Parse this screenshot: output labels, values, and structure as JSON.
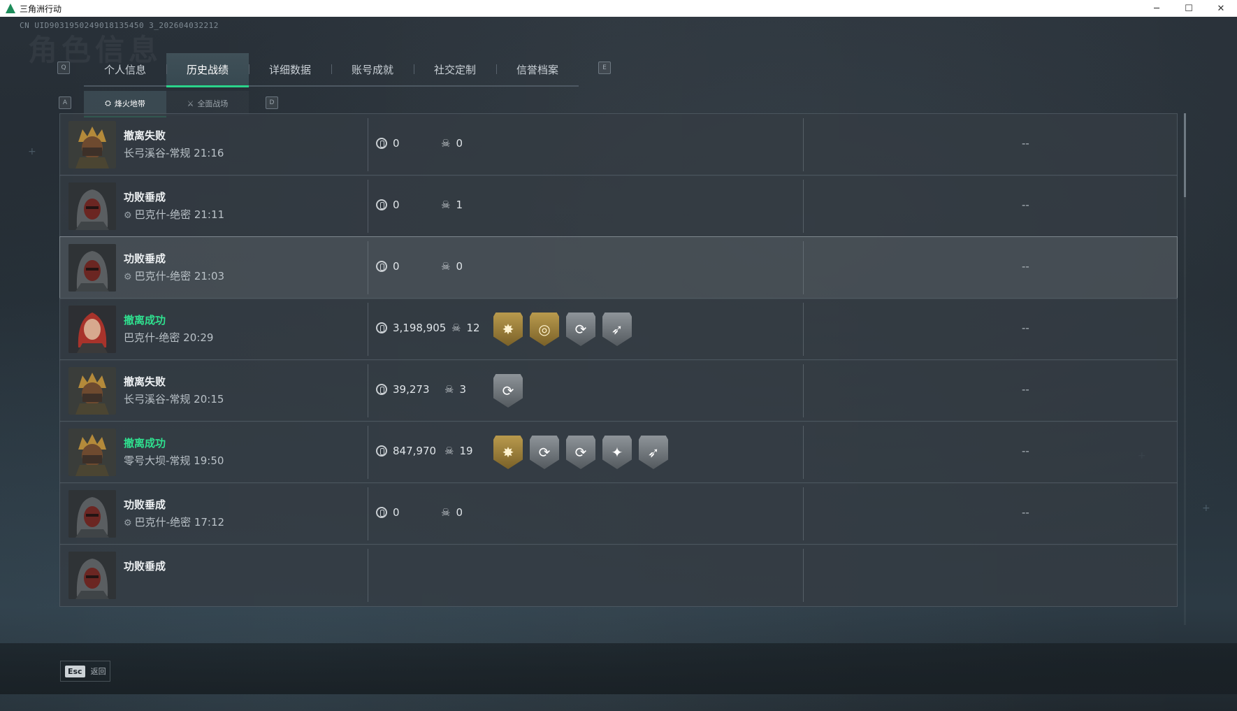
{
  "window": {
    "title": "三角洲行动",
    "controls": [
      "─",
      "☐",
      "✕"
    ]
  },
  "uid": "CN UID9031950249018135450 3_202604032212",
  "ghost_title": "角色信息",
  "key_hints": {
    "prev_main": "Q",
    "next_main": "E",
    "prev_sub": "A",
    "next_sub": "D"
  },
  "main_tabs": [
    {
      "label": "个人信息",
      "active": false
    },
    {
      "label": "历史战绩",
      "active": true
    },
    {
      "label": "详细数据",
      "active": false
    },
    {
      "label": "账号成就",
      "active": false
    },
    {
      "label": "社交定制",
      "active": false
    },
    {
      "label": "信誉档案",
      "active": false
    }
  ],
  "sub_tabs": [
    {
      "label": "烽火地带",
      "icon": "⛭",
      "active": true
    },
    {
      "label": "全面战场",
      "icon": "⚔",
      "active": false
    }
  ],
  "records": [
    {
      "result": "撤离失败",
      "success": false,
      "mode_icon": false,
      "map": "长弓溪谷-常规 21:16",
      "coins": "0",
      "kills": "0",
      "badges": [],
      "extra": "--",
      "avatar": "gold",
      "highlight": false
    },
    {
      "result": "功败垂成",
      "success": false,
      "mode_icon": true,
      "map": "巴克什-绝密 21:11",
      "coins": "0",
      "kills": "1",
      "badges": [],
      "extra": "--",
      "avatar": "hood",
      "highlight": false
    },
    {
      "result": "功败垂成",
      "success": false,
      "mode_icon": true,
      "map": "巴克什-绝密 21:03",
      "coins": "0",
      "kills": "0",
      "badges": [],
      "extra": "--",
      "avatar": "hood",
      "highlight": true
    },
    {
      "result": "撤离成功",
      "success": true,
      "mode_icon": false,
      "map": "巴克什-绝密 20:29",
      "coins": "3,198,905",
      "kills": "12",
      "badges": [
        "gold-sun",
        "gold-target",
        "silver-reload",
        "silver-gun"
      ],
      "extra": "--",
      "avatar": "red",
      "highlight": false
    },
    {
      "result": "撤离失败",
      "success": false,
      "mode_icon": false,
      "map": "长弓溪谷-常规 20:15",
      "coins": "39,273",
      "kills": "3",
      "badges": [
        "silver-reload"
      ],
      "extra": "--",
      "avatar": "gold",
      "highlight": false
    },
    {
      "result": "撤离成功",
      "success": true,
      "mode_icon": false,
      "map": "零号大坝-常规 19:50",
      "coins": "847,970",
      "kills": "19",
      "badges": [
        "gold-sun",
        "silver-reload",
        "silver-reload",
        "silver-star",
        "silver-gun"
      ],
      "extra": "--",
      "avatar": "gold",
      "highlight": false
    },
    {
      "result": "功败垂成",
      "success": false,
      "mode_icon": true,
      "map": "巴克什-绝密 17:12",
      "coins": "0",
      "kills": "0",
      "badges": [],
      "extra": "--",
      "avatar": "hood",
      "highlight": false
    },
    {
      "result": "功败垂成",
      "success": false,
      "mode_icon": false,
      "map": "",
      "coins": "",
      "kills": "",
      "badges": [],
      "extra": "",
      "avatar": "hood",
      "highlight": false
    }
  ],
  "badge_glyphs": {
    "gold-sun": "✸",
    "gold-target": "◎",
    "silver-reload": "⟳",
    "silver-gun": "➶",
    "silver-star": "✦"
  },
  "colors": {
    "accent": "#29d48a",
    "success_text": "#2fe08f"
  },
  "footer": {
    "esc_key": "Esc",
    "esc_label": "返回"
  }
}
